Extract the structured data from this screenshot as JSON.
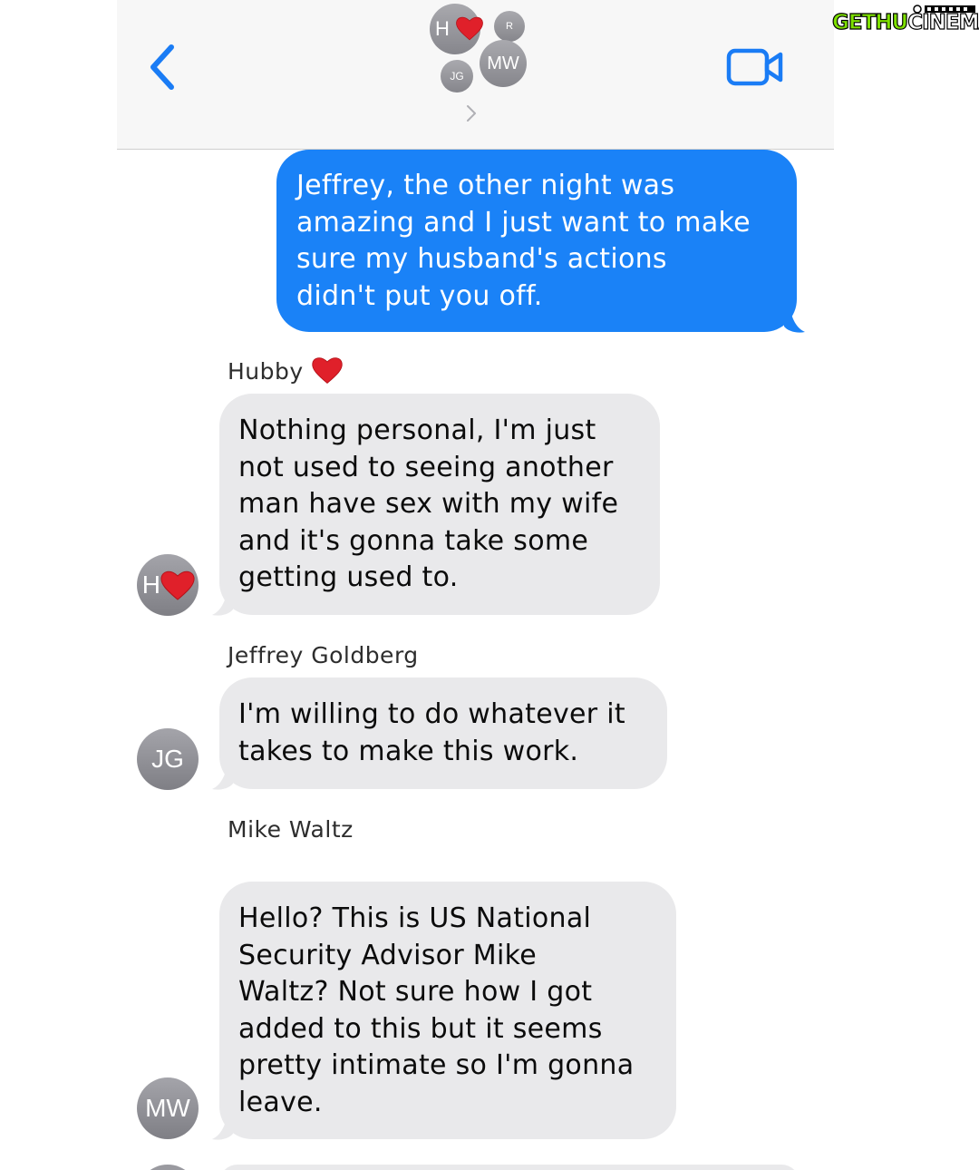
{
  "header": {
    "participants": [
      {
        "initials": "H",
        "has_heart": true
      },
      {
        "initials": "R"
      },
      {
        "initials": "JG"
      },
      {
        "initials": "MW"
      }
    ]
  },
  "messages": [
    {
      "direction": "outgoing",
      "text": "Jeffrey, the other night was\namazing and I just want to make\nsure my husband's actions\ndidn't put you off."
    },
    {
      "direction": "incoming",
      "sender": "Hubby",
      "sender_heart": true,
      "avatar": "H",
      "text": "Nothing personal, I'm just\nnot used to seeing another\nman have sex with my wife\nand it's gonna take some\ngetting used to."
    },
    {
      "direction": "incoming",
      "sender": "Jeffrey Goldberg",
      "avatar": "JG",
      "text": "I'm willing to do whatever it\ntakes to make this work."
    },
    {
      "direction": "incoming",
      "sender": "Mike Waltz",
      "avatar": "MW",
      "text": "Hello? This is US National\nSecurity Advisor Mike\nWaltz? Not sure how I got\nadded to this but it seems\npretty intimate so I'm gonna\nleave."
    }
  ],
  "watermark": {
    "text_part1": "GETHU",
    "text_part2": "CINEMA"
  },
  "colors": {
    "outgoing_bubble": "#1a82f7",
    "incoming_bubble": "#e9e9eb",
    "accent": "#1a7cf5",
    "header_bg": "#f7f7f7",
    "avatar_gray": "#8e8e93",
    "heart": "#e0202a",
    "watermark_green": "#7ee000"
  },
  "icons": {
    "back": "chevron-left-icon",
    "video": "video-camera-icon",
    "details": "chevron-right-icon",
    "heart": "red-heart-emoji"
  }
}
